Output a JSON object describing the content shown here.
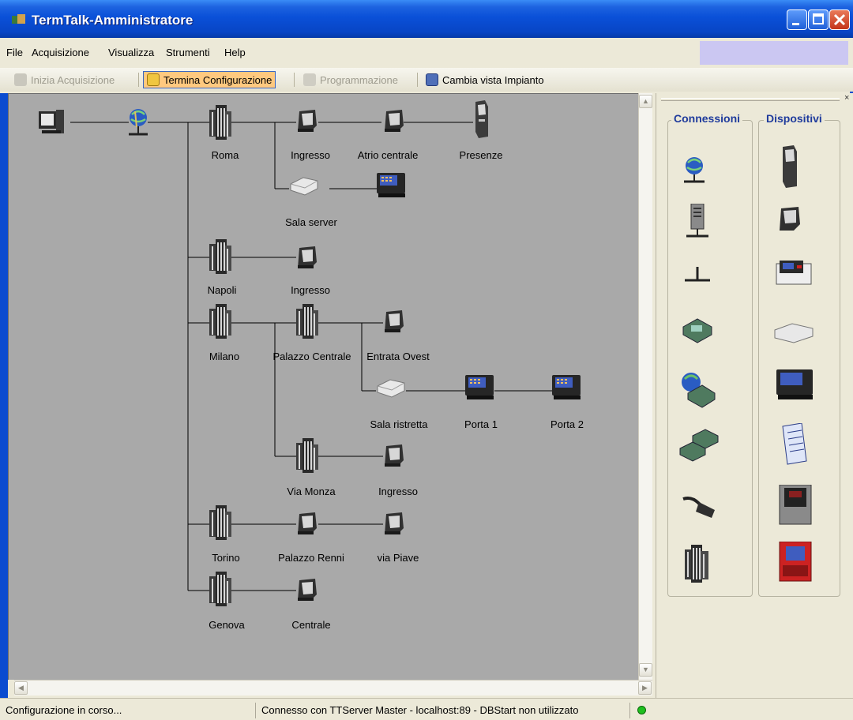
{
  "window": {
    "title": "TermTalk-Amministratore"
  },
  "menu": {
    "items": [
      "File",
      "Acquisizione",
      "Visualizza",
      "Strumenti",
      "Help"
    ]
  },
  "toolbar": {
    "start_acquisition": "Inizia Acquisizione",
    "end_configuration": "Termina Configurazione",
    "programming": "Programmazione",
    "change_view": "Cambia vista Impianto"
  },
  "tree": {
    "nodes": [
      {
        "id": "pc",
        "label": "",
        "type": "computer-icon"
      },
      {
        "id": "net",
        "label": "",
        "type": "network-connection-icon"
      },
      {
        "id": "roma",
        "label": "Roma",
        "type": "building-icon"
      },
      {
        "id": "roma-ingresso",
        "label": "Ingresso",
        "type": "terminal-icon"
      },
      {
        "id": "roma-atrio",
        "label": "Atrio centrale",
        "type": "terminal-icon"
      },
      {
        "id": "roma-presenze",
        "label": "Presenze",
        "type": "kiosk-icon"
      },
      {
        "id": "roma-salaserver",
        "label": "Sala server",
        "type": "controller-box-icon"
      },
      {
        "id": "roma-salaserver-term",
        "label": "",
        "type": "keypad-terminal-icon"
      },
      {
        "id": "napoli",
        "label": "Napoli",
        "type": "building-icon"
      },
      {
        "id": "napoli-ingresso",
        "label": "Ingresso",
        "type": "terminal-icon"
      },
      {
        "id": "milano",
        "label": "Milano",
        "type": "building-icon"
      },
      {
        "id": "palazzo-centrale",
        "label": "Palazzo Centrale",
        "type": "building-icon"
      },
      {
        "id": "entrata-ovest",
        "label": "Entrata Ovest",
        "type": "terminal-icon"
      },
      {
        "id": "sala-ristretta",
        "label": "Sala ristretta",
        "type": "controller-box-icon"
      },
      {
        "id": "porta-1",
        "label": "Porta 1",
        "type": "keypad-terminal-icon"
      },
      {
        "id": "porta-2",
        "label": "Porta 2",
        "type": "keypad-terminal-icon"
      },
      {
        "id": "via-monza",
        "label": "Via Monza",
        "type": "building-icon"
      },
      {
        "id": "via-monza-ingresso",
        "label": "Ingresso",
        "type": "terminal-icon"
      },
      {
        "id": "torino",
        "label": "Torino",
        "type": "building-icon"
      },
      {
        "id": "palazzo-renni",
        "label": "Palazzo Renni",
        "type": "terminal-icon"
      },
      {
        "id": "via-piave",
        "label": "via Piave",
        "type": "terminal-icon"
      },
      {
        "id": "genova",
        "label": "Genova",
        "type": "building-icon"
      },
      {
        "id": "genova-centrale",
        "label": "Centrale",
        "type": "terminal-icon"
      }
    ]
  },
  "palette": {
    "connections_title": "Connessioni",
    "devices_title": "Dispositivi",
    "connections": [
      "network-connection-icon",
      "server-connection-icon",
      "local-connection-icon",
      "modem-icon",
      "internet-modem-icon",
      "modem-pair-icon",
      "serial-cable-icon",
      "building-icon"
    ],
    "devices": [
      "kiosk-icon",
      "terminal-icon",
      "printer-terminal-icon",
      "controller-box-icon",
      "keypad-terminal-icon",
      "document-icon",
      "wall-terminal-icon",
      "red-terminal-icon"
    ]
  },
  "status": {
    "left": "Configurazione in corso...",
    "middle": "Connesso con TTServer Master - localhost:89 - DBStart non utilizzato",
    "indicator_color": "#1fbf1f"
  },
  "colors": {
    "titlebar": "#0a50d8",
    "canvas": "#a9a9a9",
    "highlight": "#ffc97f",
    "group_title": "#1f3b9c"
  }
}
